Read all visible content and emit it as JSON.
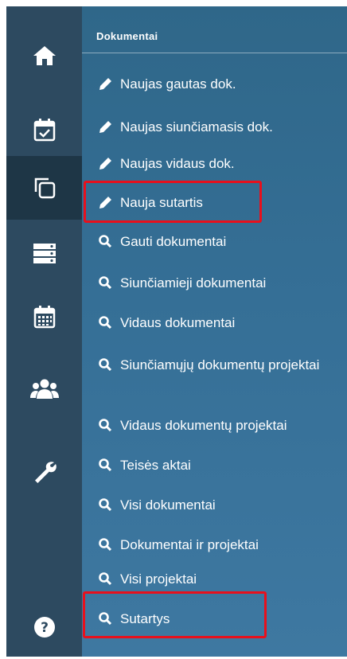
{
  "sidebar": {
    "items": [
      {
        "icon": "home-icon"
      },
      {
        "icon": "calendar-check-icon"
      },
      {
        "icon": "documents-copy-icon",
        "active": true
      },
      {
        "icon": "list-stack-icon"
      },
      {
        "icon": "calendar-grid-icon"
      },
      {
        "icon": "users-icon"
      },
      {
        "icon": "wrench-icon"
      },
      {
        "icon": "help-icon"
      }
    ]
  },
  "panel": {
    "title": "Dokumentai",
    "items": [
      {
        "label": "Naujas gautas dok.",
        "icon": "pencil-icon"
      },
      {
        "label": "Naujas siunčiamasis dok.",
        "icon": "pencil-icon"
      },
      {
        "label": "Naujas vidaus dok.",
        "icon": "pencil-icon"
      },
      {
        "label": "Nauja sutartis",
        "icon": "pencil-icon",
        "highlighted": true
      },
      {
        "label": "Gauti dokumentai",
        "icon": "search-icon"
      },
      {
        "label": "Siunčiamieji dokumentai",
        "icon": "search-icon"
      },
      {
        "label": "Vidaus dokumentai",
        "icon": "search-icon"
      },
      {
        "label": "Siunčiamųjų dokumentų projektai",
        "icon": "search-icon"
      },
      {
        "label": "Vidaus dokumentų projektai",
        "icon": "search-icon"
      },
      {
        "label": "Teisės aktai",
        "icon": "search-icon"
      },
      {
        "label": "Visi dokumentai",
        "icon": "search-icon"
      },
      {
        "label": "Dokumentai ir projektai",
        "icon": "search-icon"
      },
      {
        "label": "Visi projektai",
        "icon": "search-icon"
      },
      {
        "label": "Sutartys",
        "icon": "search-icon",
        "highlighted": true
      }
    ]
  },
  "colors": {
    "sidebar_bg": "#2d4a60",
    "sidebar_active_bg": "#1e3646",
    "panel_bg": "#356f96",
    "highlight": "#e8101c",
    "text": "#ffffff"
  }
}
